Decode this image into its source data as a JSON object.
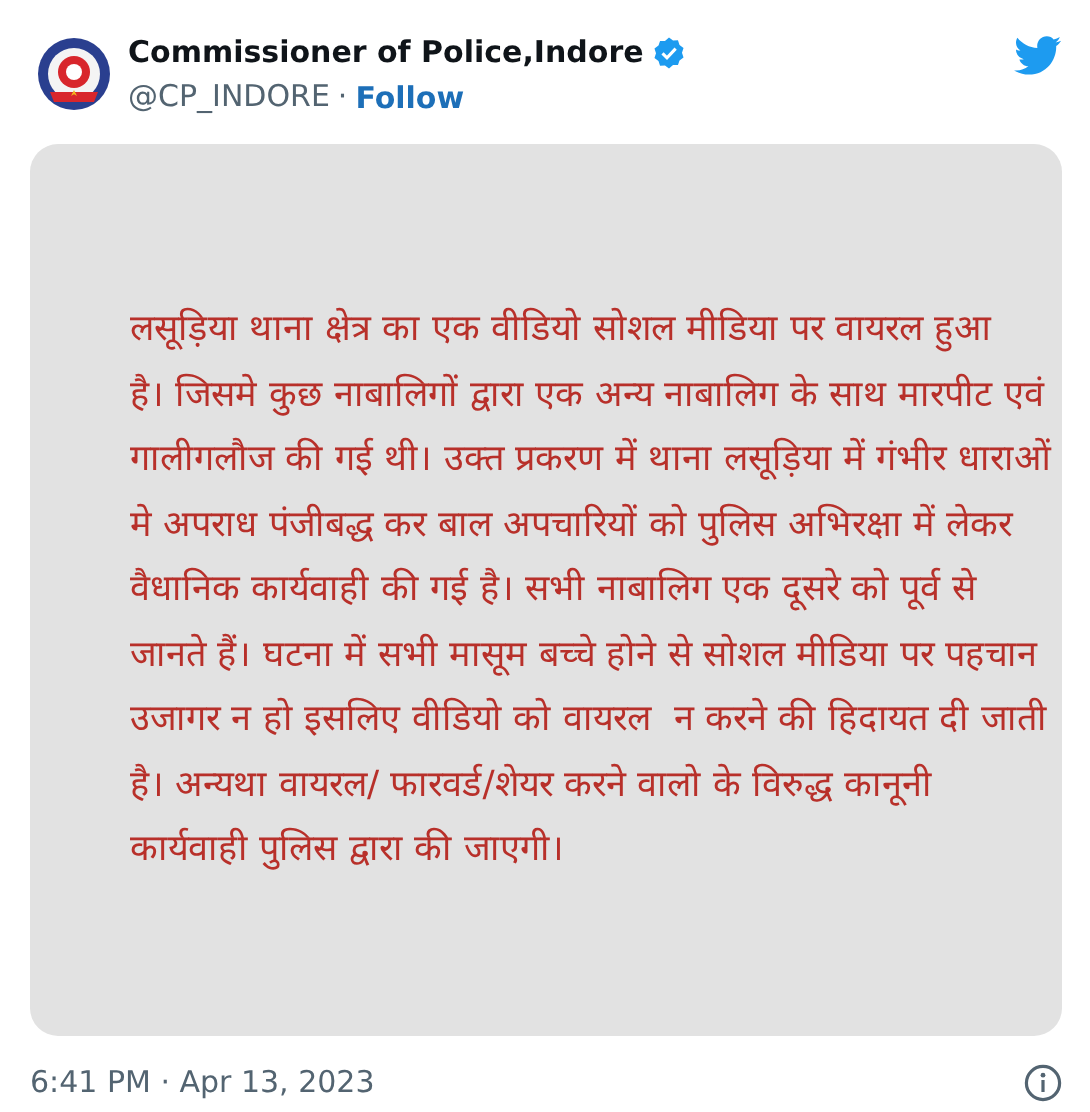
{
  "author": {
    "name": "Commissioner of Police,Indore",
    "verified": true,
    "handle": "@CP_INDORE",
    "separator": "·",
    "follow": "Follow"
  },
  "image": {
    "lines": [
      "लसूड़िया थाना क्षेत्र का एक वीडियो सोशल मीडिया पर वायरल हुआ",
      "है। जिसमे कुछ नाबालिगों द्वारा एक अन्य नाबालिग के साथ मारपीट एवं",
      "गालीगलौज की गई थी। उक्त प्रकरण में थाना लसूड़िया में गंभीर धाराओं",
      "मे अपराध पंजीबद्ध कर बाल अपचारियों को पुलिस अभिरक्षा में लेकर",
      "वैधानिक कार्यवाही की गई है। सभी नाबालिग एक दूसरे को पूर्व से",
      "जानते हैं। घटना में सभी मासूम बच्चे होने से सोशल मीडिया पर पहचान",
      "उजागर न हो इसलिए वीडियो को वायरल  न करने की हिदायत दी जाती",
      "है। अन्यथा वायरल/ फारवर्ड/शेयर करने वालो के विरुद्ध कानूनी",
      "कार्यवाही पुलिस द्वारा की जाएगी।"
    ]
  },
  "timestamp": "6:41 PM · Apr 13, 2023"
}
